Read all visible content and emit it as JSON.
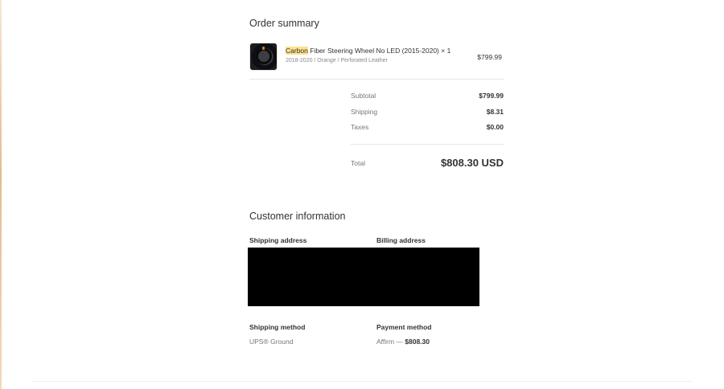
{
  "order_summary": {
    "title": "Order summary",
    "item": {
      "name_highlight": "Carbon",
      "name_rest": " Fiber Steering Wheel No LED (2015-2020) × 1",
      "variant": "2018-2020 / Orange / Perforated Leather",
      "price": "$799.99",
      "thumbnail_icon": "steering-wheel-image"
    },
    "lines": [
      {
        "label": "Subtotal",
        "value": "$799.99"
      },
      {
        "label": "Shipping",
        "value": "$8.31"
      },
      {
        "label": "Taxes",
        "value": "$0.00"
      }
    ],
    "total": {
      "label": "Total",
      "value": "$808.30 USD"
    }
  },
  "customer_information": {
    "title": "Customer information",
    "shipping_address_label": "Shipping address",
    "billing_address_label": "Billing address",
    "shipping_method_label": "Shipping method",
    "shipping_method_value": "UPS® Ground",
    "payment_method_label": "Payment method",
    "payment_method_prefix": "Affirm — ",
    "payment_method_amount": "$808.30"
  },
  "colors": {
    "highlight": "#fbe28f",
    "redaction": "#000000"
  }
}
